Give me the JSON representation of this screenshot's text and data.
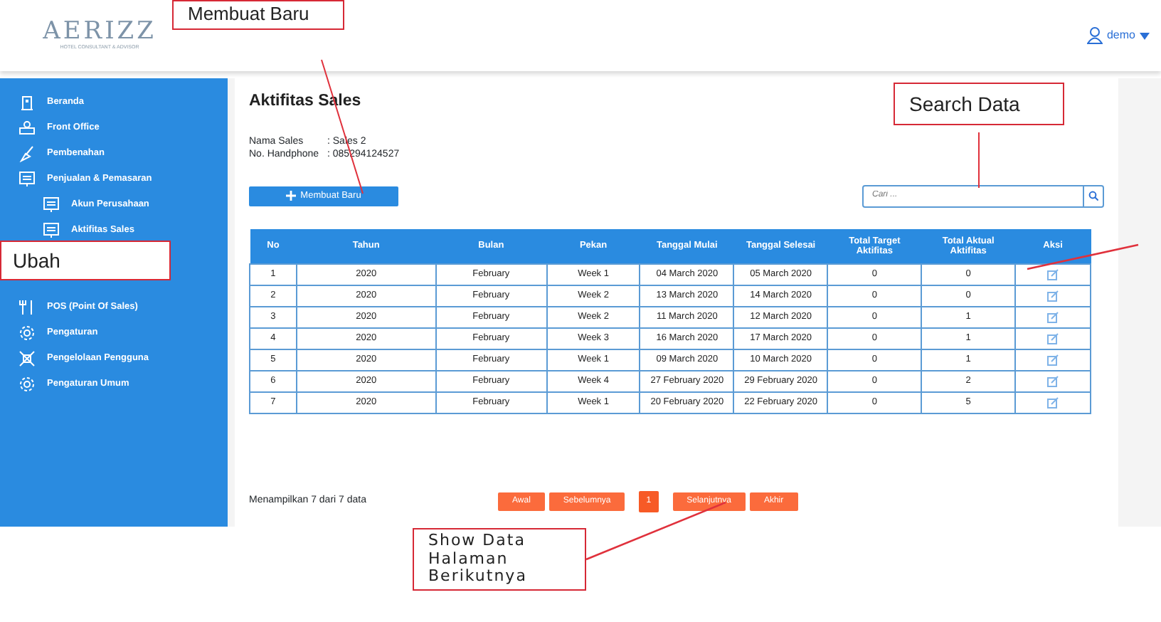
{
  "header": {
    "logo_text": "AERIZZ",
    "logo_tagline": "HOTEL CONSULTANT & ADVISOR",
    "user": "demo"
  },
  "sidebar": {
    "items": [
      {
        "label": "Beranda",
        "kind": "main"
      },
      {
        "label": "Front Office",
        "kind": "main"
      },
      {
        "label": "Pembenahan",
        "kind": "main"
      },
      {
        "label": "Penjualan & Pemasaran",
        "kind": "main"
      },
      {
        "label": "Akun Perusahaan",
        "kind": "sub"
      },
      {
        "label": "Aktifitas Sales",
        "kind": "sub"
      },
      {
        "label": "POS (Point Of Sales)",
        "kind": "main"
      },
      {
        "label": "Pengaturan",
        "kind": "main"
      },
      {
        "label": "Pengelolaan Pengguna",
        "kind": "main"
      },
      {
        "label": "Pengaturan Umum",
        "kind": "main"
      }
    ]
  },
  "page": {
    "title": "Aktifitas Sales",
    "info": [
      {
        "label": "Nama Sales",
        "value": ": Sales 2"
      },
      {
        "label": "No. Handphone",
        "value": ": 085294124527"
      }
    ],
    "create_button": "Membuat Baru",
    "search": {
      "placeholder": "Cari ..."
    }
  },
  "table": {
    "columns": [
      "No",
      "Tahun",
      "Bulan",
      "Pekan",
      "Tanggal Mulai",
      "Tanggal Selesai",
      "Total Target Aktifitas",
      "Total Aktual Aktifitas",
      "Aksi"
    ],
    "rows": [
      [
        "1",
        "2020",
        "February",
        "Week 1",
        "04 March 2020",
        "05 March 2020",
        "0",
        "0"
      ],
      [
        "2",
        "2020",
        "February",
        "Week 2",
        "13 March 2020",
        "14 March 2020",
        "0",
        "0"
      ],
      [
        "3",
        "2020",
        "February",
        "Week 2",
        "11 March 2020",
        "12 March 2020",
        "0",
        "1"
      ],
      [
        "4",
        "2020",
        "February",
        "Week 3",
        "16 March 2020",
        "17 March 2020",
        "0",
        "1"
      ],
      [
        "5",
        "2020",
        "February",
        "Week 1",
        "09 March 2020",
        "10 March 2020",
        "0",
        "1"
      ],
      [
        "6",
        "2020",
        "February",
        "Week 4",
        "27 February 2020",
        "29 February 2020",
        "0",
        "2"
      ],
      [
        "7",
        "2020",
        "February",
        "Week 1",
        "20 February 2020",
        "22 February 2020",
        "0",
        "5"
      ]
    ]
  },
  "footer": {
    "summary": "Menampilkan 7 dari 7 data",
    "pagination": [
      {
        "label": "Awal",
        "kind": "nav",
        "selected": false
      },
      {
        "label": "Sebelumnya",
        "kind": "nav",
        "selected": false
      },
      {
        "label": "1",
        "kind": "page",
        "selected": true
      },
      {
        "label": "Selanjutnya",
        "kind": "nav",
        "selected": false
      },
      {
        "label": "Akhir",
        "kind": "nav",
        "selected": false
      }
    ]
  },
  "annotations": [
    {
      "text": "Membuat Baru"
    },
    {
      "text": "Search Data"
    },
    {
      "text": "Ubah"
    },
    {
      "text": "Show Data Halaman Berikutnya"
    }
  ]
}
